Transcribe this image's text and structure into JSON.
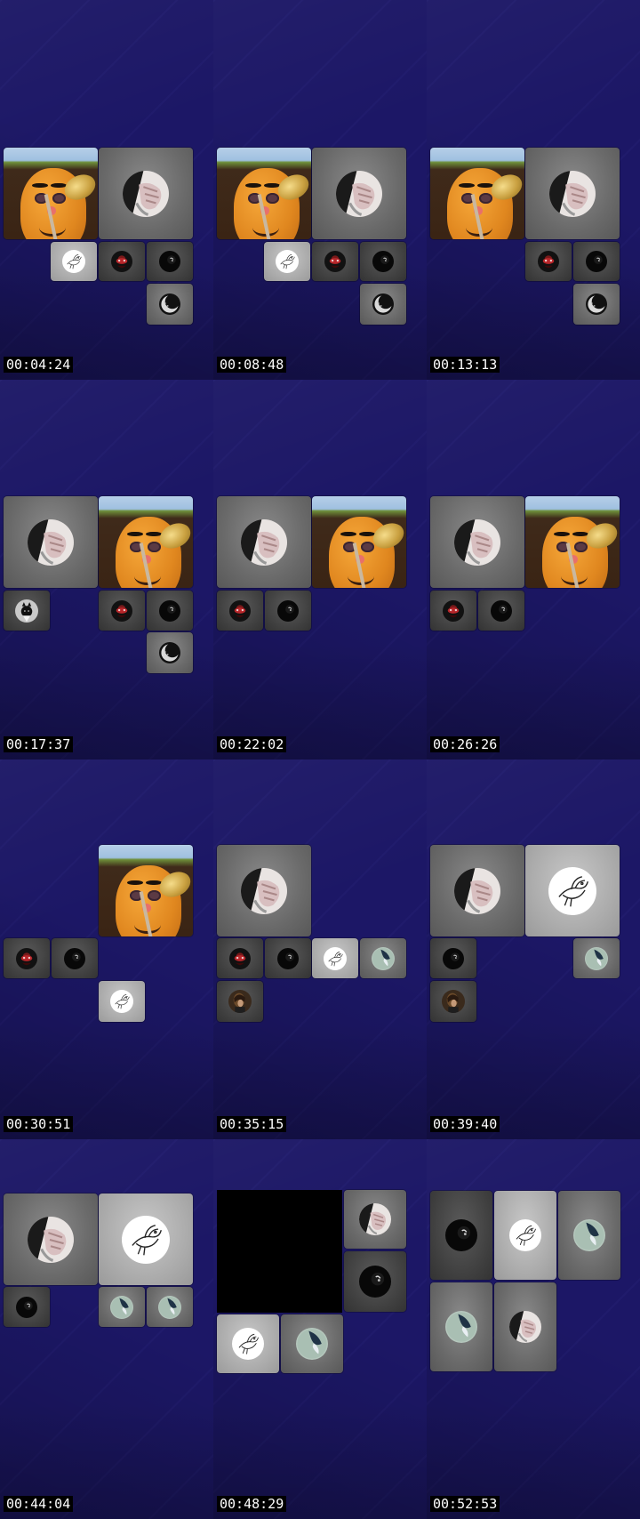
{
  "contact_sheet": {
    "frames": [
      {
        "timestamp": "00:04:24"
      },
      {
        "timestamp": "00:08:48"
      },
      {
        "timestamp": "00:13:13"
      },
      {
        "timestamp": "00:17:37"
      },
      {
        "timestamp": "00:22:02"
      },
      {
        "timestamp": "00:26:26"
      },
      {
        "timestamp": "00:30:51"
      },
      {
        "timestamp": "00:35:15"
      },
      {
        "timestamp": "00:39:40"
      },
      {
        "timestamp": "00:44:04"
      },
      {
        "timestamp": "00:48:29"
      },
      {
        "timestamp": "00:52:53"
      }
    ]
  },
  "avatars": {
    "hand": "hand-avatar-icon",
    "bird": "bird-drawing-avatar-icon",
    "red": "red-figure-avatar-icon",
    "dark": "dark-avatar-icon",
    "moon": "moon-avatar-icon",
    "earth": "earth-avatar-icon",
    "person": "person-avatar-icon",
    "cat": "cat-avatar-icon",
    "potato": "potato-video-feed"
  },
  "colors": {
    "background": "#16125e",
    "timestamp_bg": "#000000",
    "timestamp_text": "#ffffff",
    "tile_gray": "#6a6a6a",
    "tile_dark": "#3e3e3e",
    "tile_light": "#a8a8a8"
  }
}
